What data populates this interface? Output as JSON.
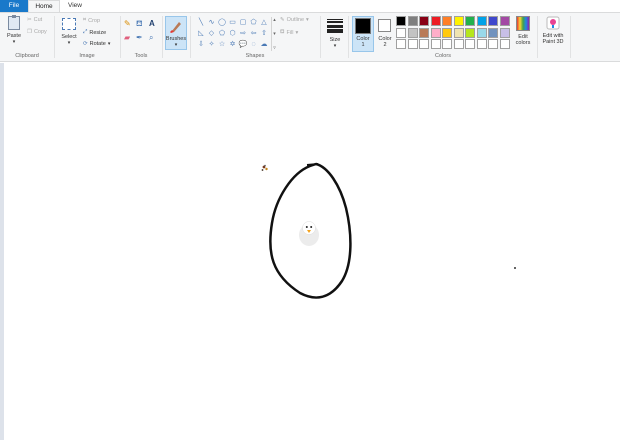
{
  "tabs": {
    "file": "File",
    "home": "Home",
    "view": "View"
  },
  "clipboard": {
    "paste": "Paste",
    "cut": "Cut",
    "copy": "Copy",
    "group": "Clipboard"
  },
  "image": {
    "select": "Select",
    "crop": "Crop",
    "resize": "Resize",
    "rotate": "Rotate",
    "group": "Image"
  },
  "tools": {
    "group": "Tools",
    "text_glyph": "A"
  },
  "brushes": {
    "label": "Brushes"
  },
  "shapes": {
    "outline": "Outline",
    "fill": "Fill",
    "group": "Shapes"
  },
  "size": {
    "label": "Size"
  },
  "colors": {
    "color1_label": "Color\n1",
    "color2_label": "Color\n2",
    "group": "Colors",
    "edit_colors": "Edit\ncolors",
    "color1": "#000000",
    "color2": "#ffffff",
    "palette": [
      "#000000",
      "#7f7f7f",
      "#880015",
      "#ed1c24",
      "#ff7f27",
      "#fff200",
      "#22b14c",
      "#00a2e8",
      "#3f48cc",
      "#a349a4",
      "#ffffff",
      "#c3c3c3",
      "#b97a57",
      "#ffaec9",
      "#ffc90e",
      "#efe4b0",
      "#b5e61d",
      "#99d9ea",
      "#7092be",
      "#c8bfe7",
      "#ffffff",
      "#ffffff",
      "#ffffff",
      "#ffffff",
      "#ffffff",
      "#ffffff",
      "#ffffff",
      "#ffffff",
      "#ffffff",
      "#ffffff"
    ]
  },
  "paint3d": {
    "label": "Edit with\nPaint 3D"
  },
  "icons": [
    "paste-icon",
    "cut-icon",
    "copy-icon",
    "select-icon",
    "crop-icon",
    "resize-icon",
    "rotate-icon",
    "pencil-icon",
    "fill-icon",
    "text-icon",
    "eraser-icon",
    "color-picker-icon",
    "magnifier-icon",
    "brush-icon",
    "size-icon",
    "edit-colors-icon",
    "paint3d-icon"
  ]
}
